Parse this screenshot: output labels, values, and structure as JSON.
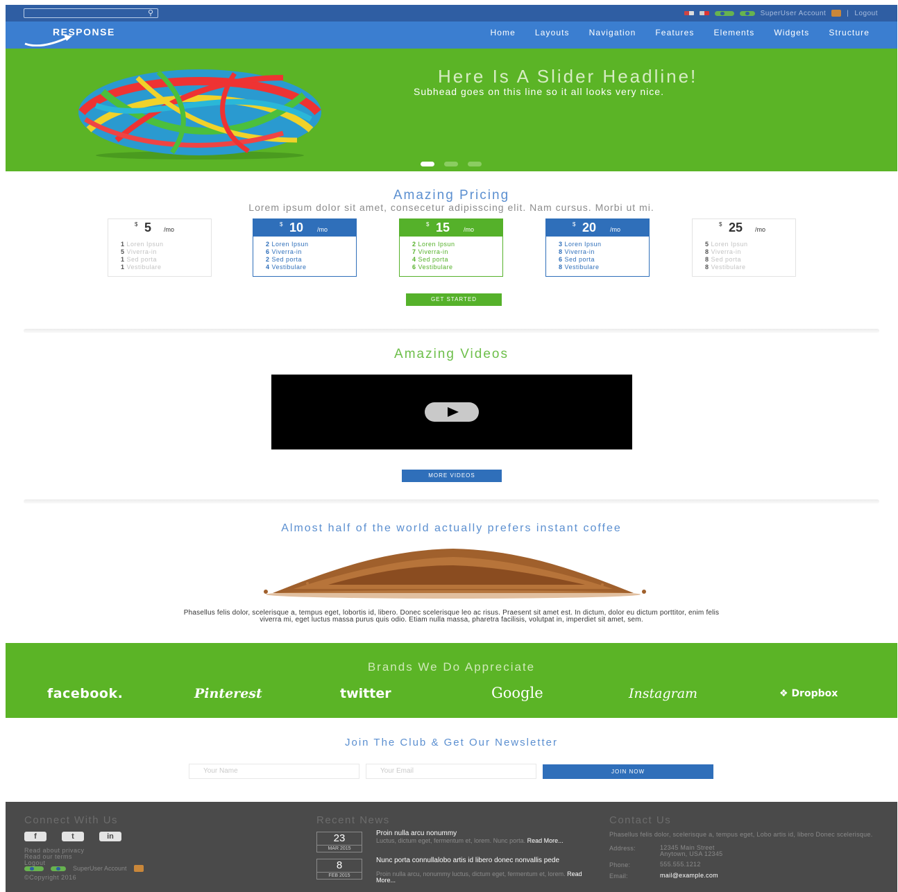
{
  "topbar": {
    "search_placeholder": "",
    "account_label": "SuperUser Account",
    "logout_label": "Logout",
    "separator": "|"
  },
  "brand": {
    "logo_text": "RESPONSE"
  },
  "nav": {
    "items": [
      "Home",
      "Layouts",
      "Navigation",
      "Features",
      "Elements",
      "Widgets",
      "Structure"
    ]
  },
  "hero": {
    "headline": "Here Is A Slider Headline!",
    "subhead": "Subhead goes on this line so it all looks very nice.",
    "slides_count": 3,
    "active_slide": 1
  },
  "pricing": {
    "title": "Amazing Pricing",
    "description": "Lorem ipsum dolor sit amet, consecetur adipisscing elit. Nam cursus. Morbi ut mi.",
    "currency": "$",
    "per": "/mo",
    "plans": [
      {
        "price": "5",
        "style": "plain",
        "features": [
          [
            "1",
            "Loren Ipsun"
          ],
          [
            "5",
            "Viverra-in"
          ],
          [
            "1",
            "Sed porta"
          ],
          [
            "1",
            "Vestibulare"
          ]
        ]
      },
      {
        "price": "10",
        "style": "blue",
        "features": [
          [
            "2",
            "Loren Ipsun"
          ],
          [
            "6",
            "Viverra-in"
          ],
          [
            "2",
            "Sed porta"
          ],
          [
            "4",
            "Vestibulare"
          ]
        ]
      },
      {
        "price": "15",
        "style": "green",
        "features": [
          [
            "2",
            "Loren Ipsun"
          ],
          [
            "7",
            "Viverra-in"
          ],
          [
            "4",
            "Sed porta"
          ],
          [
            "6",
            "Vestibulare"
          ]
        ]
      },
      {
        "price": "20",
        "style": "blue",
        "features": [
          [
            "3",
            "Loren Ipsun"
          ],
          [
            "8",
            "Viverra-in"
          ],
          [
            "6",
            "Sed porta"
          ],
          [
            "8",
            "Vestibulare"
          ]
        ]
      },
      {
        "price": "25",
        "style": "plain",
        "features": [
          [
            "5",
            "Loren Ipsun"
          ],
          [
            "8",
            "Viverra-in"
          ],
          [
            "8",
            "Sed porta"
          ],
          [
            "8",
            "Vestibulare"
          ]
        ]
      }
    ],
    "cta": "GET STARTED"
  },
  "videos": {
    "title": "Amazing Videos",
    "cta": "MORE VIDEOS"
  },
  "coffee": {
    "title": "Almost half of the world actually prefers instant coffee",
    "text": "Phasellus felis dolor, scelerisque a, tempus eget, lobortis id, libero. Donec scelerisque leo ac risus. Praesent sit amet est. In dictum, dolor eu dictum porttitor, enim felis viverra mi, eget luctus massa purus quis odio. Etiam nulla massa, pharetra facilisis, volutpat in, imperdiet sit amet, sem."
  },
  "brands": {
    "title": "Brands We Do Appreciate",
    "items": [
      "facebook.",
      "Pinterest",
      "twitter",
      "Google",
      "Instagram",
      "Dropbox"
    ]
  },
  "newsletter": {
    "title": "Join The Club & Get Our Newsletter",
    "name_placeholder": "Your Name",
    "email_placeholder": "Your Email",
    "button": "JOIN NOW"
  },
  "footer": {
    "connect": {
      "title": "Connect With Us",
      "social": [
        "f",
        "t",
        "in"
      ],
      "links": [
        "Read about privacy",
        "Read our terms",
        "Logout"
      ],
      "account": "SuperUser Account",
      "copyright": "©Copyright 2016"
    },
    "news": {
      "title": "Recent News",
      "items": [
        {
          "day": "23",
          "month": "MAR 2015",
          "title": "Proin nulla arcu nonummy",
          "body": "Luctus, dictum eget, fermentum et, lorem. Nunc porta.",
          "more": "Read More..."
        },
        {
          "day": "8",
          "month": "FEB 2015",
          "title": "Nunc porta connullalobo artis id libero donec nonvallis pede",
          "body": "Proin nulla arcu, nonummy luctus, dictum eget, fermentum et, lorem.",
          "more": "Read More..."
        }
      ]
    },
    "contact": {
      "title": "Contact Us",
      "description": "Phasellus felis dolor, scelerisque a, tempus eget, Lobo artis id, libero Donec scelerisque.",
      "address_label": "Address:",
      "address_line1": "12345 Main Street",
      "address_line2": "Anytown, USA 12345",
      "phone_label": "Phone:",
      "phone": "555.555.1212",
      "email_label": "Email:",
      "email": "mail@example.com"
    }
  },
  "colors": {
    "blue_dark": "#2f5ea3",
    "blue_nav": "#3b7ed0",
    "green": "#5bb426",
    "footer": "#4a4a4a"
  }
}
